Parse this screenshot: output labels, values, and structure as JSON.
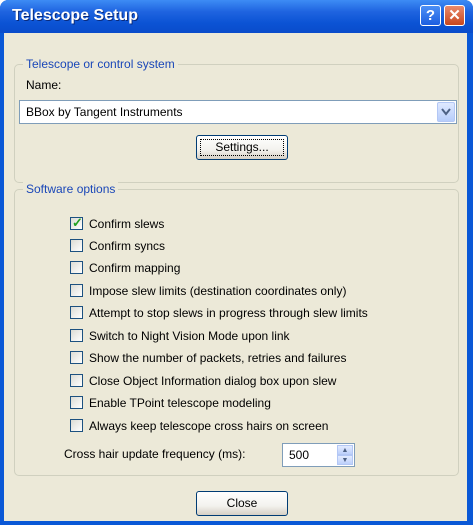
{
  "window": {
    "title": "Telescope Setup",
    "help_button": "?",
    "close_button": "✕"
  },
  "telescope_group": {
    "label": "Telescope or control system",
    "name_label": "Name:",
    "selected": "BBox by Tangent Instruments",
    "settings_button": "Settings..."
  },
  "software_group": {
    "label": "Software options",
    "options": [
      {
        "label": "Confirm slews",
        "checked": true
      },
      {
        "label": "Confirm syncs",
        "checked": false
      },
      {
        "label": "Confirm mapping",
        "checked": false
      },
      {
        "label": "Impose slew limits (destination coordinates only)",
        "checked": false
      },
      {
        "label": "Attempt to stop slews in progress through slew limits",
        "checked": false
      },
      {
        "label": "Switch to Night Vision Mode upon link",
        "checked": false
      },
      {
        "label": "Show the number of packets, retries and failures",
        "checked": false
      },
      {
        "label": "Close Object Information dialog box upon slew",
        "checked": false
      },
      {
        "label": "Enable TPoint telescope modeling",
        "checked": false
      },
      {
        "label": "Always keep telescope cross hairs on screen",
        "checked": false
      }
    ],
    "freq_label": "Cross hair update frequency (ms):",
    "freq_value": "500"
  },
  "footer": {
    "close_button": "Close"
  },
  "icons": {
    "check": "✓",
    "dropdown": "chevron-down-icon",
    "spin_up": "▲",
    "spin_down": "▼"
  }
}
